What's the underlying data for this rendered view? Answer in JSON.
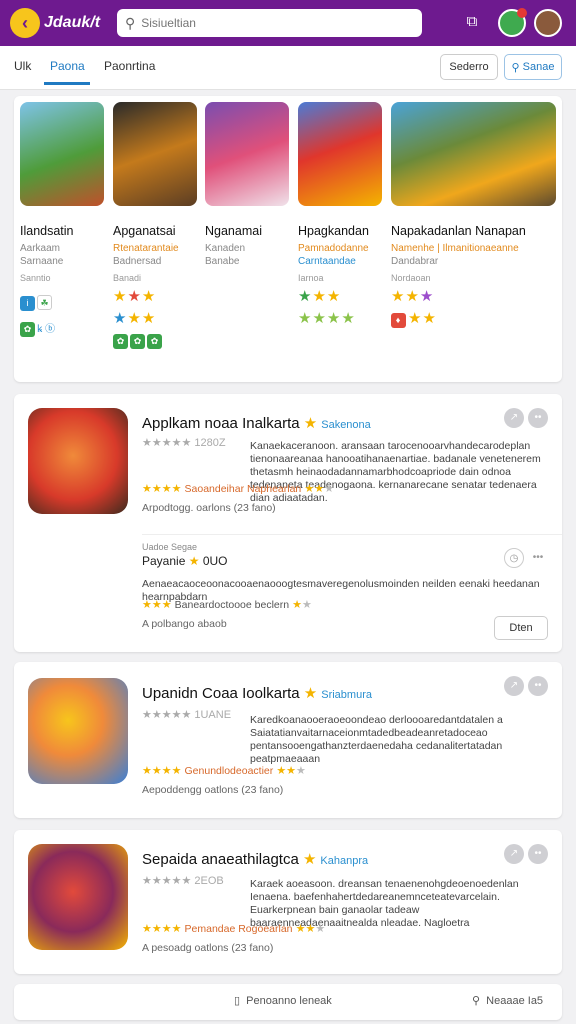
{
  "header": {
    "logo_text": "Jdauk/t",
    "search_placeholder": "Sisiueltian"
  },
  "tabs": [
    {
      "label": "Ulk"
    },
    {
      "label": "Paona"
    },
    {
      "label": "Paonrtina"
    }
  ],
  "actions": {
    "button1": "Sederro",
    "button2": "Sanae"
  },
  "featured": [
    {
      "title": "Ilandsatin",
      "sub1": "Aarkaam",
      "sub2": "Sarnaane",
      "sub3": "Sanntio",
      "stars": "",
      "minis": [
        "ⓘ",
        "☘"
      ],
      "minis2": [
        "✿",
        "ꝃ",
        "ⓑ"
      ]
    },
    {
      "title": "Apganatsai",
      "sub1": "Rtenatarantaie",
      "sub2": "Badnersad",
      "sub3": "Banadi",
      "stars1": "★★★",
      "stars2": "★★★",
      "minis2": [
        "✿",
        "✿",
        "✿"
      ]
    },
    {
      "title": "Nganamai",
      "sub1": "Kanaden",
      "sub2": "Banabe",
      "sub3": "",
      "stars1": "",
      "stars2": ""
    },
    {
      "title": "Hpagkandan",
      "sub1": "Pamnadodanne",
      "sub2": "Carntaandae",
      "sub3": "Iarnoa",
      "stars1": "★★★",
      "stars2": "★★★★"
    },
    {
      "title": "Napakadanlan Nanapan",
      "sub1": "Namenhe | Ilmanitionaeanne",
      "sub2": "Dandabrar",
      "sub3": "Nordaoan",
      "stars1": "★★★",
      "stars2": "★★"
    }
  ],
  "apps": [
    {
      "title": "Applkam noaa Inalkarta",
      "tag": "Sakenona",
      "rating_text": "★★★★★ 1280Z",
      "desc": "Kanaekaceranoon. aransaan tarocenooarvhandecarodeplan tienonaareanaa hanooatihanaenartiae. badanale venetenerem thetasmh heinaodadannamarbhodcoapriode dain odnoa tedenaneta teadenogaona. kernanarecane senatar tedenaera dian adiaatadan.",
      "tagline_org": "Saoandeihar Naphearlan",
      "meta": "Arpodtogg. oarlons (23 fano)",
      "sub_label": "Uadoe Segae",
      "sub_title": "Payanie",
      "sub_count": "0UO",
      "sub_desc": "Aenaeacaoceoonacooaenaooogtesmaveregenolusmoinden neilden eenaki heedanan hearnpabdarn",
      "sub_tagline_org": "Baneardoctoooe beclern",
      "sub_meta": "A polbango abaob",
      "sub_button": "Dten"
    },
    {
      "title": "Upanidn Coaa Ioolkarta",
      "tag": "Sriabmura",
      "rating_text": "★★★★★ 1UANE",
      "desc": "Karedkoanaooeraoeoondeao derloooaredantdatalen a Saiatatianvaitarnaceionmtadedbeadeanretadoceao pentansooengathanzterdaenedaha cedanalitertatadan peatpmaeaaan",
      "tagline_org": "Genundlodeoactier",
      "meta": "Aepoddengg oatlons (23 fano)"
    },
    {
      "title": "Sepaida anaeathilagtca",
      "tag": "Kahanpra",
      "rating_text": "★★★★★ 2EOB",
      "desc": "Karaek aoeasoon. dreansan tenaenenohgdeoenoedenlan Ienaena. baefenhahertdedareanemnceteatevarcelain. Euarkerpnean bain ganaolar tadeaw baaraenneadaenaaitnealda nleadae. Nagloetra",
      "tagline_org": "Pemandae Rogoearlan",
      "meta": "A pesoadg oatlons (23 fano)"
    }
  ],
  "bottom": {
    "left_label": "Penoanno leneak",
    "right_label": "Neaaae Ia5"
  },
  "colors": {
    "topbar": "#6e1a8f",
    "accent": "#1f7ac2",
    "star": "#f4b400"
  }
}
